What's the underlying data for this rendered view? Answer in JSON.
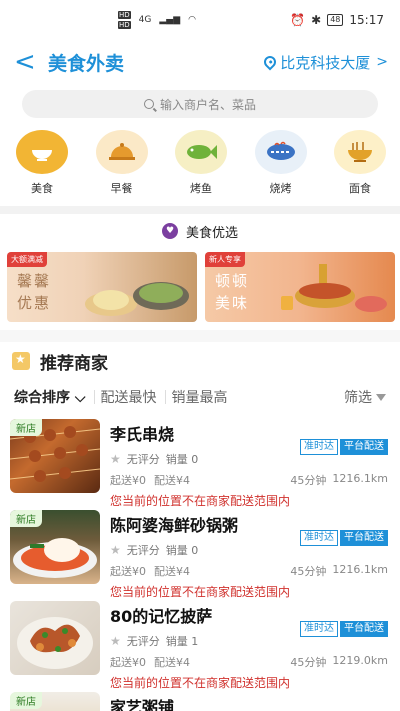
{
  "status": {
    "sim1": "HD",
    "sim2": "HD",
    "net": "4G",
    "battery": "48",
    "time": "15:17"
  },
  "nav": {
    "title": "美食外卖",
    "location": "比克科技大厦"
  },
  "search": {
    "placeholder": "输入商户名、菜品"
  },
  "categories": [
    {
      "label": "美食",
      "color": "#f2b534"
    },
    {
      "label": "早餐",
      "color": "#fbe9c7"
    },
    {
      "label": "烤鱼",
      "color": "#f6efc4"
    },
    {
      "label": "烧烤",
      "color": "#e8f0f8"
    },
    {
      "label": "面食",
      "color": "#fdf0c8"
    }
  ],
  "featured": {
    "title": "美食优选"
  },
  "banners": [
    {
      "tag": "大额满减",
      "text1": "馨馨",
      "text2": "优惠"
    },
    {
      "tag": "新人专享",
      "text1": "顿顿",
      "text2": "美味"
    }
  ],
  "recommend": {
    "title": "推荐商家"
  },
  "sort": {
    "default": "综合排序",
    "fastest": "配送最快",
    "sales": "销量最高",
    "filter": "筛选"
  },
  "shops": [
    {
      "tag": "新店",
      "name": "李氏串烧",
      "rating": "无评分",
      "sales": "销量 0",
      "min": "起送¥0",
      "fee": "配送¥4",
      "time": "45分钟",
      "dist": "1216.1km",
      "badge1": "准时达",
      "badge2": "平台配送",
      "warn": "您当前的位置不在商家配送范围内"
    },
    {
      "tag": "新店",
      "name": "陈阿婆海鲜砂锅粥",
      "rating": "无评分",
      "sales": "销量 0",
      "min": "起送¥0",
      "fee": "配送¥4",
      "time": "45分钟",
      "dist": "1216.1km",
      "badge1": "准时达",
      "badge2": "平台配送",
      "warn": "您当前的位置不在商家配送范围内"
    },
    {
      "tag": "",
      "name": "80的记忆披萨",
      "rating": "无评分",
      "sales": "销量 1",
      "min": "起送¥0",
      "fee": "配送¥4",
      "time": "45分钟",
      "dist": "1219.0km",
      "badge1": "准时达",
      "badge2": "平台配送",
      "warn": "您当前的位置不在商家配送范围内"
    },
    {
      "tag": "新店",
      "name": "家艺粥铺"
    }
  ]
}
